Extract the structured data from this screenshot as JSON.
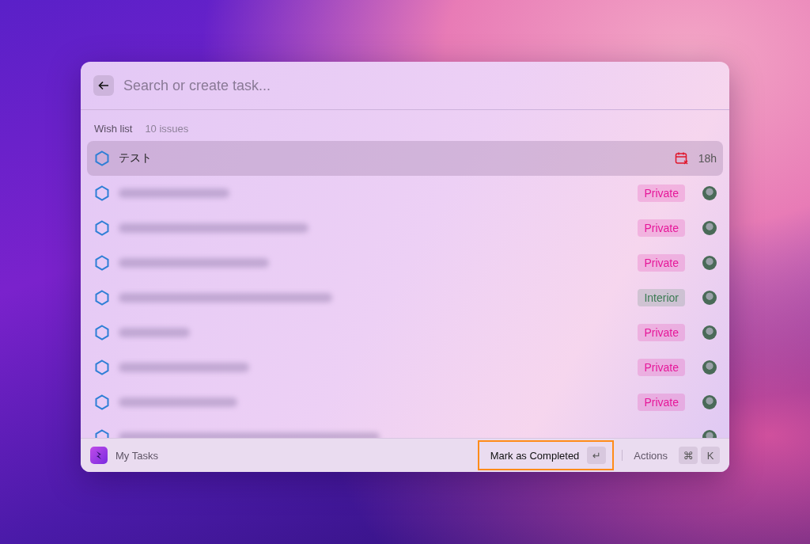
{
  "search": {
    "placeholder": "Search or create task..."
  },
  "list": {
    "title": "Wish list",
    "count": "10 issues"
  },
  "rows": [
    {
      "kind": "titled",
      "title": "テスト",
      "selected": true,
      "due": "18h",
      "overdue": true
    },
    {
      "kind": "blurred",
      "selected": false,
      "label": "Private",
      "color": "#e6189a"
    },
    {
      "kind": "blurred",
      "selected": false,
      "label": "Private",
      "color": "#e6189a"
    },
    {
      "kind": "blurred",
      "selected": false,
      "label": "Private",
      "color": "#e6189a"
    },
    {
      "kind": "blurred",
      "selected": false,
      "label": "Interior",
      "color": "#3a7a52"
    },
    {
      "kind": "blurred",
      "selected": false,
      "label": "Private",
      "color": "#e6189a"
    },
    {
      "kind": "blurred",
      "selected": false,
      "label": "Private",
      "color": "#e6189a"
    },
    {
      "kind": "blurred",
      "selected": false,
      "label": "Private",
      "color": "#e6189a"
    },
    {
      "kind": "blurred",
      "selected": false
    }
  ],
  "footer": {
    "app": "My Tasks",
    "primary": {
      "label": "Mark as Completed",
      "key": "↵",
      "highlighted": true
    },
    "secondary": {
      "label": "Actions",
      "keys": [
        "⌘",
        "K"
      ]
    }
  }
}
